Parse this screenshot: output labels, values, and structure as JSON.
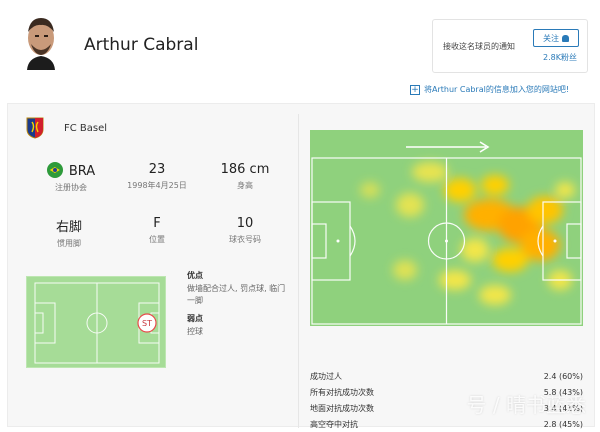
{
  "player": {
    "name": "Arthur Cabral"
  },
  "follow": {
    "notify_text": "接收这名球员的通知",
    "button_label": "关注",
    "fans": "2.8K粉丝"
  },
  "add_to_site": {
    "label": "将Arthur Cabral的信息加入您的网站吧!"
  },
  "club": {
    "name": "FC Basel"
  },
  "info": [
    {
      "value": "BRA",
      "label": "注册协会"
    },
    {
      "value": "23",
      "label": "1998年4月25日"
    },
    {
      "value": "186 cm",
      "label": "身高"
    },
    {
      "value": "右脚",
      "label": "惯用脚"
    },
    {
      "value": "F",
      "label": "位置"
    },
    {
      "value": "10",
      "label": "球衣号码"
    }
  ],
  "position_marker": "ST",
  "strengths": {
    "title": "优点",
    "body": "做墙配合过人, 罚点球, 临门一脚"
  },
  "weaknesses": {
    "title": "弱点",
    "body": "控球"
  },
  "stats": [
    {
      "label": "成功过人",
      "value": "2.4 (60%)"
    },
    {
      "label": "所有对抗成功次数",
      "value": "5.8 (43%)"
    },
    {
      "label": "地面对抗成功次数",
      "value": "3.4 (41%)"
    },
    {
      "label": "高空夺中对抗",
      "value": "2.8 (45%)"
    }
  ],
  "watermark": "号 / 晴书蓝悉",
  "colors": {
    "accent": "#2a7ab8",
    "pitch": "#a6dc97",
    "heat_high": "#ffd000"
  }
}
